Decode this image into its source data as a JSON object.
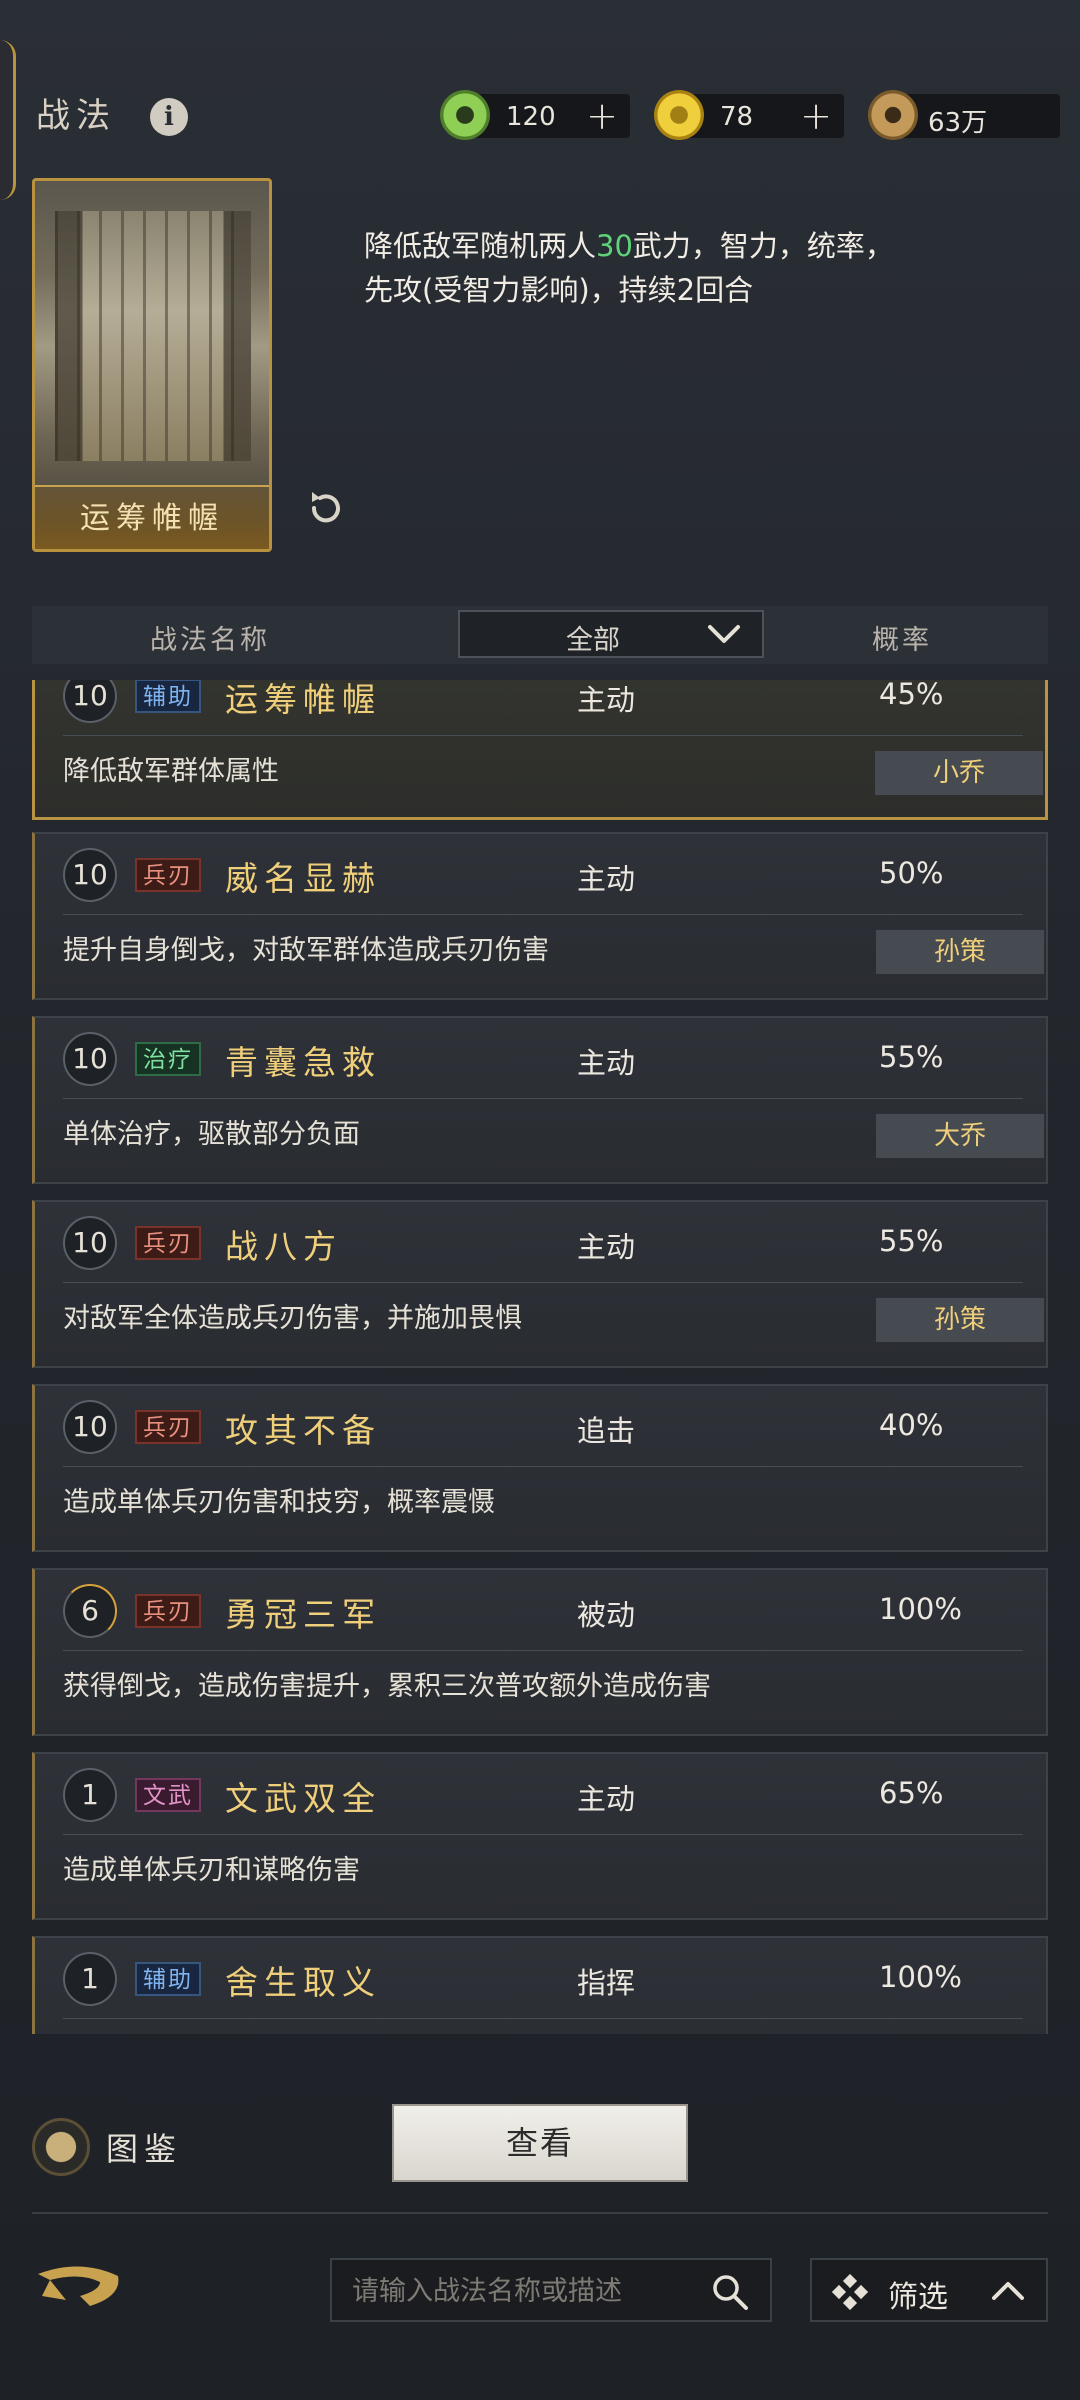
{
  "header": {
    "title": "战法",
    "currencies": [
      {
        "name": "jade-icon",
        "value": "120",
        "plus": "+",
        "color": "#7fbf4a"
      },
      {
        "name": "gold-coin-icon",
        "value": "78",
        "plus": "+",
        "color": "#d9b22a"
      },
      {
        "name": "copper-coin-icon",
        "value": "63万",
        "plus": "",
        "color": "#b08a4a"
      }
    ]
  },
  "selected_skill": {
    "card_name": "运筹帷幄",
    "desc_prefix": "降低敌军随机两人",
    "desc_value": "30",
    "desc_line1_rest": "武力，智力，统率，",
    "desc_line2": "先攻(受智力影响)，持续2回合"
  },
  "filter": {
    "col_name": "战法名称",
    "select_value": "全部",
    "col_rate": "概率"
  },
  "skills": [
    {
      "level": "10",
      "tag": "辅助",
      "tag_kind": "aux",
      "name": "运筹帷幄",
      "type": "主动",
      "rate": "45%",
      "desc": "降低敌军群体属性",
      "owner": "小乔",
      "selected": true
    },
    {
      "level": "10",
      "tag": "兵刃",
      "tag_kind": "blade",
      "name": "威名显赫",
      "type": "主动",
      "rate": "50%",
      "desc": "提升自身倒戈，对敌军群体造成兵刃伤害",
      "owner": "孙策"
    },
    {
      "level": "10",
      "tag": "治疗",
      "tag_kind": "heal",
      "name": "青囊急救",
      "type": "主动",
      "rate": "55%",
      "desc": "单体治疗，驱散部分负面",
      "owner": "大乔"
    },
    {
      "level": "10",
      "tag": "兵刃",
      "tag_kind": "blade",
      "name": "战八方",
      "type": "主动",
      "rate": "55%",
      "desc": "对敌军全体造成兵刃伤害，并施加畏惧",
      "owner": "孙策"
    },
    {
      "level": "10",
      "tag": "兵刃",
      "tag_kind": "blade",
      "name": "攻其不备",
      "type": "追击",
      "rate": "40%",
      "desc": "造成单体兵刃伤害和技穷，概率震慑",
      "owner": ""
    },
    {
      "level": "6",
      "tag": "兵刃",
      "tag_kind": "blade",
      "name": "勇冠三军",
      "type": "被动",
      "rate": "100%",
      "desc": "获得倒戈，造成伤害提升，累积三次普攻额外造成伤害",
      "owner": "",
      "partial": true
    },
    {
      "level": "1",
      "tag": "文武",
      "tag_kind": "civmil",
      "name": "文武双全",
      "type": "主动",
      "rate": "65%",
      "desc": "造成单体兵刃和谋略伤害",
      "owner": ""
    },
    {
      "level": "1",
      "tag": "辅助",
      "tag_kind": "aux",
      "name": "舍生取义",
      "type": "指挥",
      "rate": "100%",
      "desc": "",
      "owner": ""
    }
  ],
  "footer": {
    "atlas_label": "图鉴",
    "view_button": "查看",
    "search_placeholder": "请输入战法名称或描述",
    "filter_button": "筛选"
  }
}
